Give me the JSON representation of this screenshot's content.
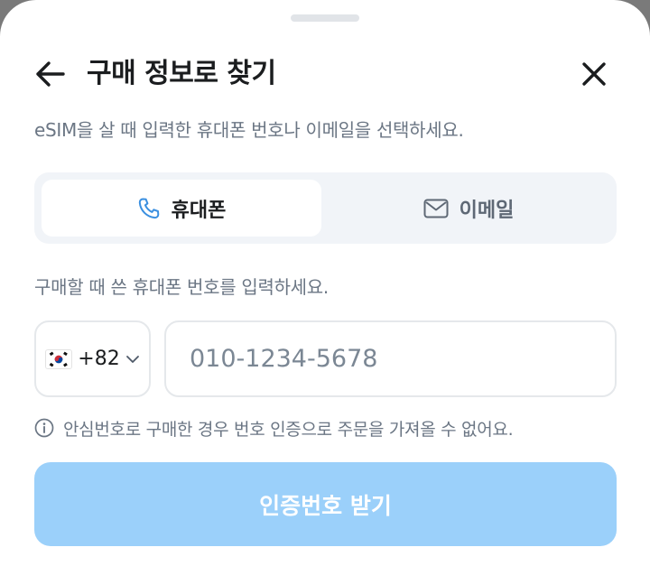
{
  "header": {
    "title": "구매 정보로 찾기",
    "back_icon": "arrow-left-icon",
    "close_icon": "close-icon"
  },
  "description": "eSIM을 살 때 입력한 휴대폰 번호나 이메일을 선택하세요.",
  "tabs": [
    {
      "label": "휴대폰",
      "icon": "phone-icon",
      "selected": true
    },
    {
      "label": "이메일",
      "icon": "mail-icon",
      "selected": false
    }
  ],
  "form": {
    "prompt": "구매할 때 쓴 휴대폰 번호를 입력하세요.",
    "country_code": "+82",
    "country_flag_icon": "korea-flag-icon",
    "phone_placeholder": "010-1234-5678"
  },
  "notice": {
    "icon": "info-icon",
    "text": "안심번호로 구매한 경우 번호 인증으로 주문을 가져올 수 없어요."
  },
  "cta": {
    "label": "인증번호 받기",
    "disabled": true
  },
  "colors": {
    "accent_phone_icon": "#3a8fe0",
    "cta_disabled": "#9bd0fa",
    "tab_bar_bg": "#f1f4f8",
    "secondary_text": "#6b7684"
  }
}
